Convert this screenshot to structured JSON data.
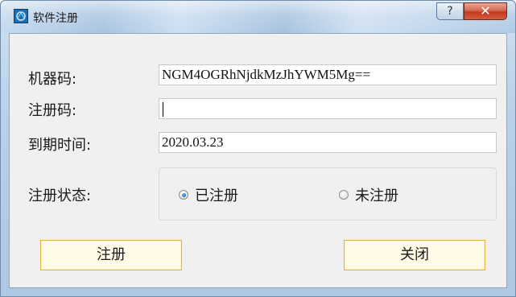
{
  "window": {
    "title": "软件注册",
    "help_button_label": "?",
    "close_button_label": "✕"
  },
  "form": {
    "machine_code_label": "机器码:",
    "machine_code_value": "NGM4OGRhNjdkMzJhYWM5Mg==",
    "reg_code_label": "注册码:",
    "reg_code_value": "",
    "expiry_label": "到期时间:",
    "expiry_value": "2020.03.23",
    "status_label": "注册状态:",
    "status_options": [
      {
        "label": "已注册",
        "checked": true
      },
      {
        "label": "未注册",
        "checked": false
      }
    ]
  },
  "buttons": {
    "register_label": "注册",
    "close_label": "关闭"
  },
  "colors": {
    "title_bar": "#b9d0e8",
    "close_button": "#c2391f",
    "button_border": "#e3b33d",
    "button_fill": "#fffbe6",
    "client_bg": "#f0f0f0"
  }
}
